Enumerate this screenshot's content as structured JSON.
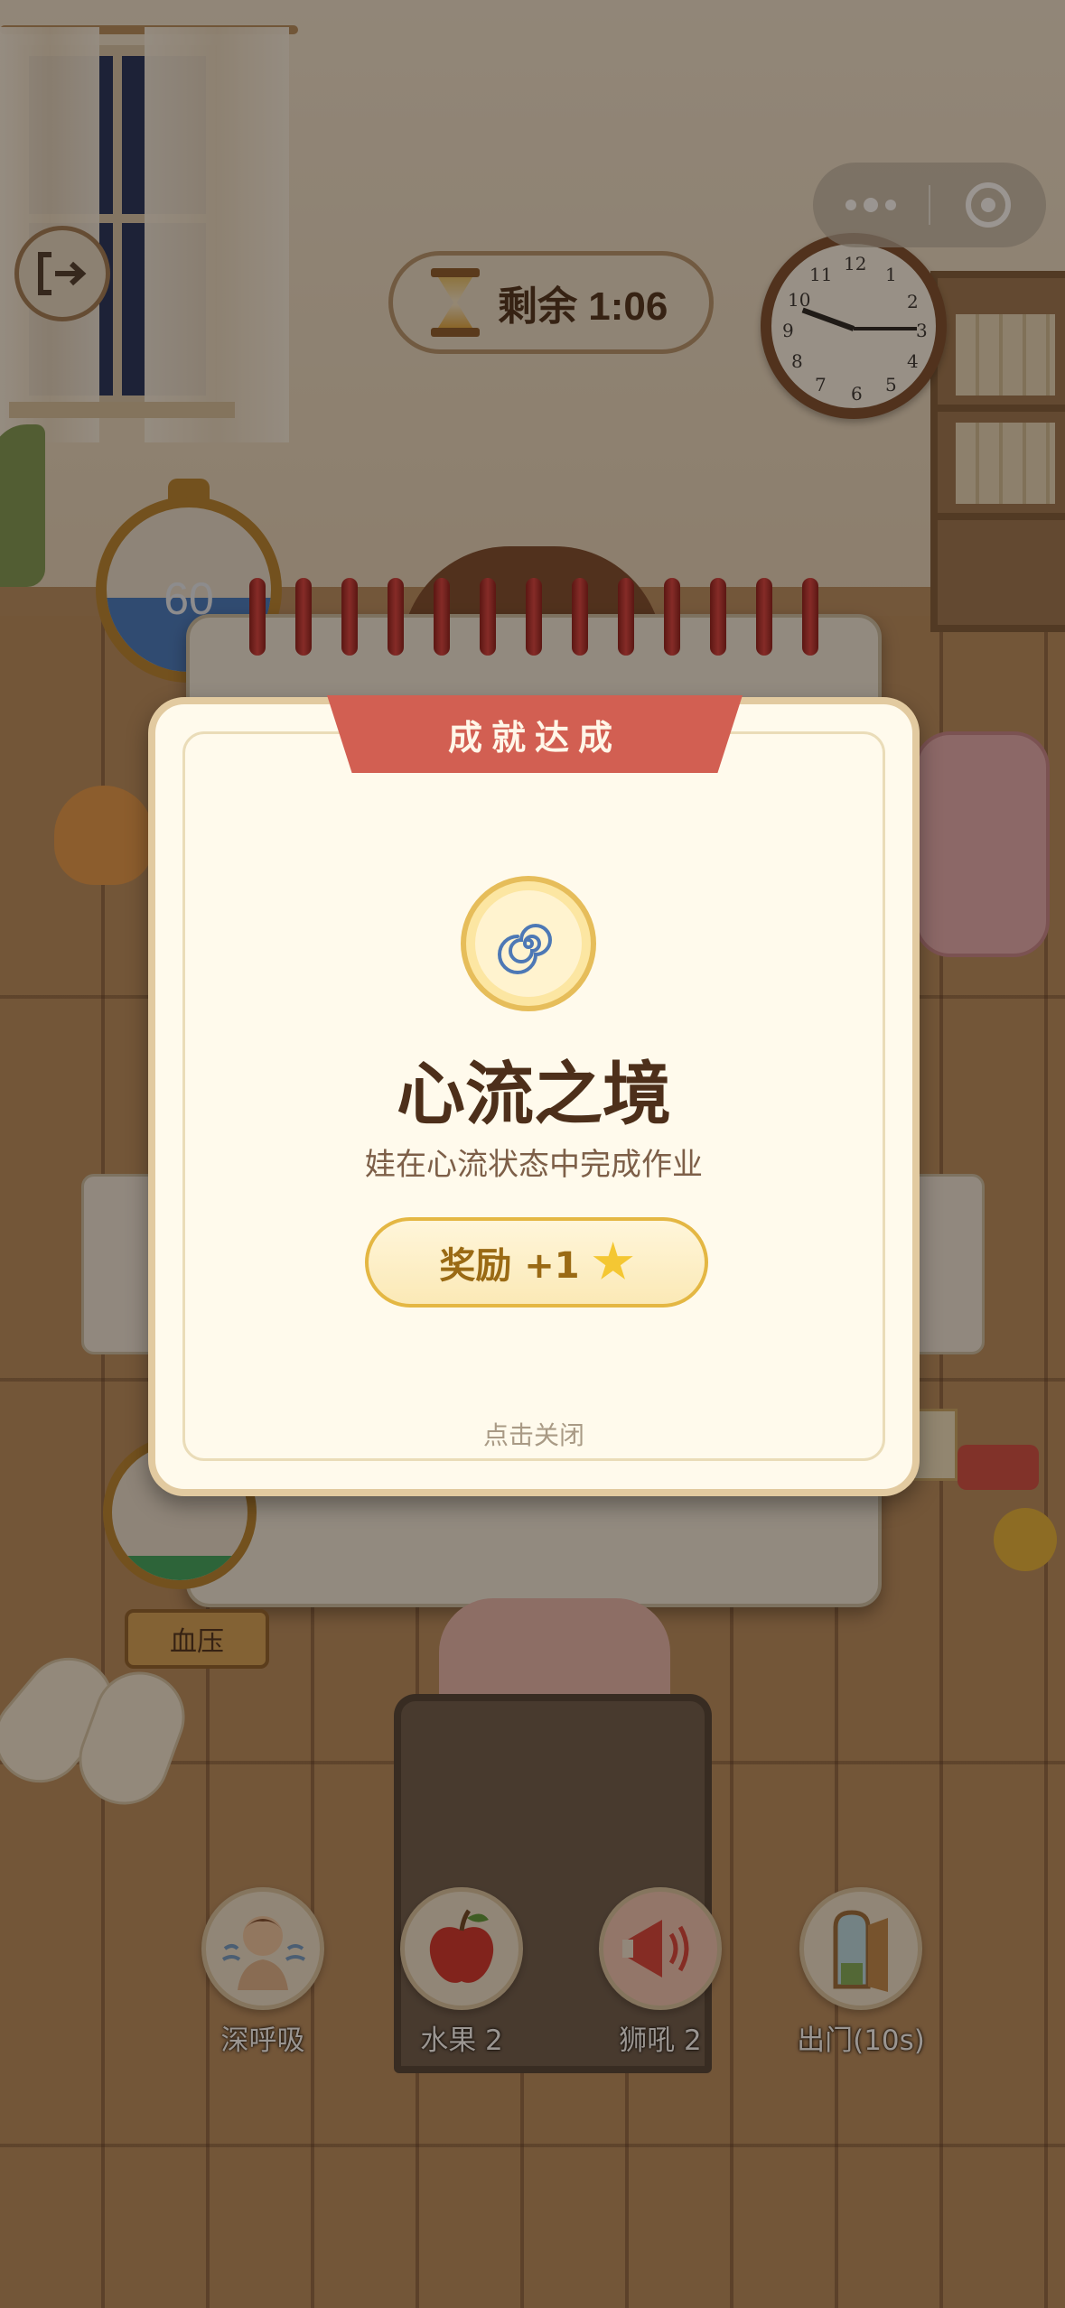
{
  "hud": {
    "timer_text": "剩余 1:06",
    "gauge_value": "60",
    "gauge_fill_percent": 45,
    "bp_label": "血压",
    "clock_numbers": [
      "12",
      "1",
      "2",
      "3",
      "4",
      "5",
      "6",
      "7",
      "8",
      "9",
      "10",
      "11"
    ]
  },
  "modal": {
    "ribbon": "成就达成",
    "title": "心流之境",
    "description": "娃在心流状态中完成作业",
    "reward": "奖励 +1",
    "close_hint": "点击关闭"
  },
  "actions": [
    {
      "label": "深呼吸",
      "icon": "deep-breath-icon"
    },
    {
      "label": "水果 2",
      "icon": "apple-icon"
    },
    {
      "label": "狮吼 2",
      "icon": "megaphone-icon"
    },
    {
      "label": "出门(10s)",
      "icon": "door-icon"
    }
  ],
  "colors": {
    "ribbon": "#d25f52",
    "reward_border": "#e4b743",
    "title": "#4d2f1a",
    "gauge_fill": "#3f79c5"
  }
}
